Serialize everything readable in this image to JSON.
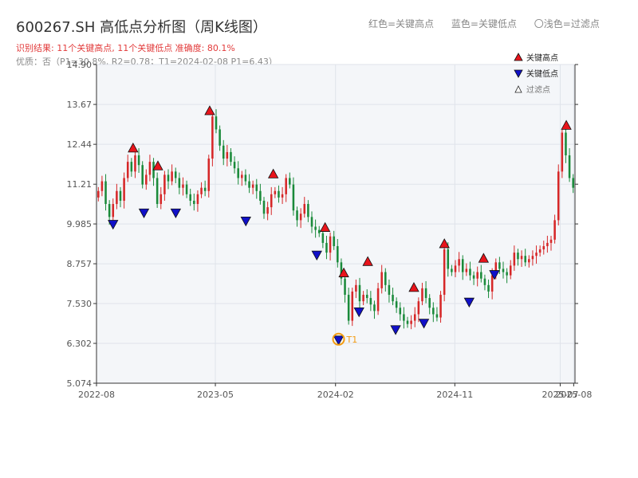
{
  "header": {
    "title": "600267.SH 高低点分析图（周K线图）",
    "legend_red": "红色=关键高点",
    "legend_blue": "蓝色=关键低点",
    "legend_light": "〇浅色=过滤点",
    "result_line": "识别结果: 11个关键高点, 11个关键低点   准确度: 80.1%",
    "quality_line": "优质：否（P1=30.8%, R2=0.78；T1=2024-02-08 P1=6.43）"
  },
  "colors": {
    "up": "#d62728",
    "down": "#1a8a3a",
    "high_marker": "#e8141b",
    "low_marker": "#1010c8",
    "t1_ring": "#f39c12",
    "plot_bg": "#f4f6f9",
    "grid": "#dfe3ea",
    "accent_text": "#e23b3b"
  },
  "chart_data": {
    "type": "candlestick",
    "title": "600267.SH 高低点分析图（周K线图）",
    "ylim": [
      5.074,
      14.9
    ],
    "y_ticks": [
      "14.90",
      "13.67",
      "12.44",
      "11.21",
      "9.985",
      "8.757",
      "7.530",
      "6.302",
      "5.074"
    ],
    "y_tick_values": [
      14.9,
      13.67,
      12.44,
      11.21,
      9.985,
      8.757,
      7.53,
      6.302,
      5.074
    ],
    "x_ticks": [
      "2022-08",
      "2023-05",
      "2024-02",
      "2024-11",
      "2025-07",
      "2025-08"
    ],
    "x_tick_dates": [
      "2022-08-01",
      "2023-05-01",
      "2024-02-01",
      "2024-11-01",
      "2025-07-01",
      "2025-08-01"
    ],
    "x_range": [
      "2022-08-01",
      "2025-08-04"
    ],
    "legend": {
      "high_label": "关键高点",
      "low_label": "关键低点",
      "filtered_label": "过滤点",
      "position": "top-right"
    },
    "t1_label": "T1",
    "t1": {
      "date": "2024-02-08",
      "price": 6.43
    },
    "key_highs": [
      {
        "date": "2022-10-24",
        "price": 12.3
      },
      {
        "date": "2022-12-20",
        "price": 11.75
      },
      {
        "date": "2023-04-18",
        "price": 13.45
      },
      {
        "date": "2023-09-11",
        "price": 11.5
      },
      {
        "date": "2024-01-08",
        "price": 9.85
      },
      {
        "date": "2024-02-20",
        "price": 8.45
      },
      {
        "date": "2024-04-15",
        "price": 8.8
      },
      {
        "date": "2024-07-30",
        "price": 8.0
      },
      {
        "date": "2024-10-08",
        "price": 9.35
      },
      {
        "date": "2025-01-06",
        "price": 8.9
      },
      {
        "date": "2025-07-15",
        "price": 13.0
      }
    ],
    "key_lows": [
      {
        "date": "2022-09-08",
        "price": 10.0
      },
      {
        "date": "2022-11-18",
        "price": 10.35
      },
      {
        "date": "2023-01-30",
        "price": 10.35
      },
      {
        "date": "2023-07-10",
        "price": 10.1
      },
      {
        "date": "2023-12-20",
        "price": 9.05
      },
      {
        "date": "2024-02-08",
        "price": 6.43
      },
      {
        "date": "2024-03-26",
        "price": 7.3
      },
      {
        "date": "2024-06-18",
        "price": 6.75
      },
      {
        "date": "2024-08-22",
        "price": 6.95
      },
      {
        "date": "2024-12-04",
        "price": 7.6
      },
      {
        "date": "2025-01-31",
        "price": 8.45
      }
    ],
    "closes": [
      11.0,
      11.3,
      10.6,
      10.2,
      10.6,
      11.0,
      10.7,
      11.4,
      11.9,
      11.6,
      12.1,
      11.8,
      11.2,
      11.5,
      11.9,
      11.4,
      10.6,
      10.9,
      11.5,
      11.3,
      11.6,
      11.4,
      11.1,
      11.2,
      10.9,
      10.7,
      10.6,
      10.9,
      11.1,
      11.0,
      12.0,
      13.3,
      12.9,
      12.4,
      12.0,
      12.2,
      11.9,
      11.7,
      11.4,
      11.5,
      11.3,
      11.1,
      11.2,
      11.0,
      10.7,
      10.3,
      10.5,
      10.9,
      11.0,
      10.8,
      10.9,
      11.4,
      11.2,
      10.4,
      10.1,
      10.3,
      10.6,
      10.2,
      9.9,
      9.8,
      9.7,
      9.4,
      9.1,
      9.6,
      9.3,
      8.8,
      8.3,
      7.8,
      7.0,
      7.9,
      8.1,
      7.6,
      7.8,
      7.7,
      7.5,
      7.3,
      8.0,
      8.5,
      8.1,
      7.8,
      7.6,
      7.4,
      7.2,
      7.0,
      6.9,
      7.0,
      7.2,
      7.6,
      8.0,
      7.7,
      7.4,
      7.2,
      7.1,
      7.8,
      9.2,
      8.6,
      8.5,
      8.7,
      8.9,
      8.5,
      8.6,
      8.4,
      8.3,
      8.5,
      8.3,
      8.1,
      7.9,
      8.4,
      8.8,
      8.6,
      8.5,
      8.4,
      8.7,
      9.1,
      8.9,
      9.0,
      8.8,
      8.9,
      9.0,
      9.1,
      9.2,
      9.3,
      9.4,
      9.5,
      10.1,
      11.6,
      12.8,
      12.1,
      11.4,
      11.1
    ]
  }
}
